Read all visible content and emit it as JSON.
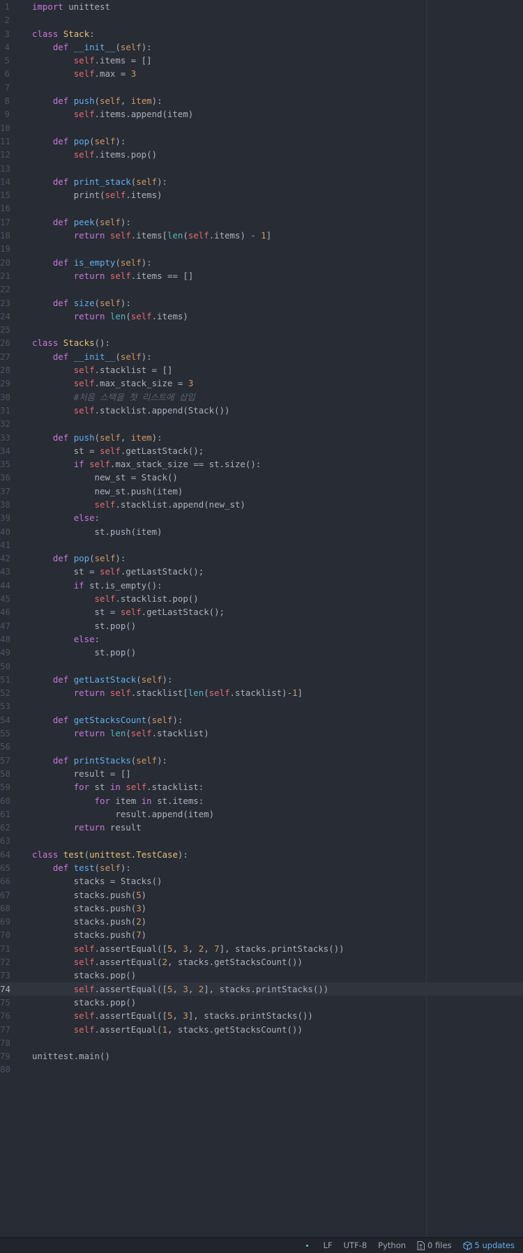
{
  "editor": {
    "cursor_line": 74,
    "colors": {
      "background": "#282c34",
      "keyword": "#c678dd",
      "class_name": "#e5c07b",
      "function": "#61afef",
      "self": "#e06c75",
      "number": "#d19a66",
      "builtin": "#56b6c2",
      "comment": "#5c6370",
      "text": "#abb2bf"
    },
    "lines": [
      [
        [
          "k",
          "import"
        ],
        [
          "t",
          " unittest"
        ]
      ],
      [],
      [
        [
          "k",
          "class"
        ],
        [
          "t",
          " "
        ],
        [
          "cls",
          "Stack"
        ],
        [
          "t",
          ":"
        ]
      ],
      [
        [
          "t",
          "    "
        ],
        [
          "k",
          "def"
        ],
        [
          "t",
          " "
        ],
        [
          "fn",
          "__init__"
        ],
        [
          "t",
          "("
        ],
        [
          "p",
          "self"
        ],
        [
          "t",
          "):"
        ]
      ],
      [
        [
          "t",
          "        "
        ],
        [
          "s",
          "self"
        ],
        [
          "t",
          ".items = []"
        ]
      ],
      [
        [
          "t",
          "        "
        ],
        [
          "s",
          "self"
        ],
        [
          "t",
          ".max = "
        ],
        [
          "n",
          "3"
        ]
      ],
      [],
      [
        [
          "t",
          "    "
        ],
        [
          "k",
          "def"
        ],
        [
          "t",
          " "
        ],
        [
          "fn",
          "push"
        ],
        [
          "t",
          "("
        ],
        [
          "p",
          "self"
        ],
        [
          "t",
          ", "
        ],
        [
          "p",
          "item"
        ],
        [
          "t",
          "):"
        ]
      ],
      [
        [
          "t",
          "        "
        ],
        [
          "s",
          "self"
        ],
        [
          "t",
          ".items.append(item)"
        ]
      ],
      [],
      [
        [
          "t",
          "    "
        ],
        [
          "k",
          "def"
        ],
        [
          "t",
          " "
        ],
        [
          "fn",
          "pop"
        ],
        [
          "t",
          "("
        ],
        [
          "p",
          "self"
        ],
        [
          "t",
          "):"
        ]
      ],
      [
        [
          "t",
          "        "
        ],
        [
          "s",
          "self"
        ],
        [
          "t",
          ".items.pop()"
        ]
      ],
      [],
      [
        [
          "t",
          "    "
        ],
        [
          "k",
          "def"
        ],
        [
          "t",
          " "
        ],
        [
          "fn",
          "print_stack"
        ],
        [
          "t",
          "("
        ],
        [
          "p",
          "self"
        ],
        [
          "t",
          "):"
        ]
      ],
      [
        [
          "t",
          "        print("
        ],
        [
          "s",
          "self"
        ],
        [
          "t",
          ".items)"
        ]
      ],
      [],
      [
        [
          "t",
          "    "
        ],
        [
          "k",
          "def"
        ],
        [
          "t",
          " "
        ],
        [
          "fn",
          "peek"
        ],
        [
          "t",
          "("
        ],
        [
          "p",
          "self"
        ],
        [
          "t",
          "):"
        ]
      ],
      [
        [
          "t",
          "        "
        ],
        [
          "k",
          "return"
        ],
        [
          "t",
          " "
        ],
        [
          "s",
          "self"
        ],
        [
          "t",
          ".items["
        ],
        [
          "b",
          "len"
        ],
        [
          "t",
          "("
        ],
        [
          "s",
          "self"
        ],
        [
          "t",
          ".items) - "
        ],
        [
          "n",
          "1"
        ],
        [
          "t",
          "]"
        ]
      ],
      [],
      [
        [
          "t",
          "    "
        ],
        [
          "k",
          "def"
        ],
        [
          "t",
          " "
        ],
        [
          "fn",
          "is_empty"
        ],
        [
          "t",
          "("
        ],
        [
          "p",
          "self"
        ],
        [
          "t",
          "):"
        ]
      ],
      [
        [
          "t",
          "        "
        ],
        [
          "k",
          "return"
        ],
        [
          "t",
          " "
        ],
        [
          "s",
          "self"
        ],
        [
          "t",
          ".items == []"
        ]
      ],
      [],
      [
        [
          "t",
          "    "
        ],
        [
          "k",
          "def"
        ],
        [
          "t",
          " "
        ],
        [
          "fn",
          "size"
        ],
        [
          "t",
          "("
        ],
        [
          "p",
          "self"
        ],
        [
          "t",
          "):"
        ]
      ],
      [
        [
          "t",
          "        "
        ],
        [
          "k",
          "return"
        ],
        [
          "t",
          " "
        ],
        [
          "b",
          "len"
        ],
        [
          "t",
          "("
        ],
        [
          "s",
          "self"
        ],
        [
          "t",
          ".items)"
        ]
      ],
      [],
      [
        [
          "k",
          "class"
        ],
        [
          "t",
          " "
        ],
        [
          "cls",
          "Stacks"
        ],
        [
          "t",
          "():"
        ]
      ],
      [
        [
          "t",
          "    "
        ],
        [
          "k",
          "def"
        ],
        [
          "t",
          " "
        ],
        [
          "fn",
          "__init__"
        ],
        [
          "t",
          "("
        ],
        [
          "p",
          "self"
        ],
        [
          "t",
          "):"
        ]
      ],
      [
        [
          "t",
          "        "
        ],
        [
          "s",
          "self"
        ],
        [
          "t",
          ".stacklist = []"
        ]
      ],
      [
        [
          "t",
          "        "
        ],
        [
          "s",
          "self"
        ],
        [
          "t",
          ".max_stack_size = "
        ],
        [
          "n",
          "3"
        ]
      ],
      [
        [
          "t",
          "        "
        ],
        [
          "c",
          "#처음 스택을 첫 리스트에 삽입"
        ]
      ],
      [
        [
          "t",
          "        "
        ],
        [
          "s",
          "self"
        ],
        [
          "t",
          ".stacklist.append(Stack())"
        ]
      ],
      [],
      [
        [
          "t",
          "    "
        ],
        [
          "k",
          "def"
        ],
        [
          "t",
          " "
        ],
        [
          "fn",
          "push"
        ],
        [
          "t",
          "("
        ],
        [
          "p",
          "self"
        ],
        [
          "t",
          ", "
        ],
        [
          "p",
          "item"
        ],
        [
          "t",
          "):"
        ]
      ],
      [
        [
          "t",
          "        st = "
        ],
        [
          "s",
          "self"
        ],
        [
          "t",
          ".getLastStack();"
        ]
      ],
      [
        [
          "t",
          "        "
        ],
        [
          "k",
          "if"
        ],
        [
          "t",
          " "
        ],
        [
          "s",
          "self"
        ],
        [
          "t",
          ".max_stack_size == st.size():"
        ]
      ],
      [
        [
          "t",
          "            new_st = Stack()"
        ]
      ],
      [
        [
          "t",
          "            new_st.push(item)"
        ]
      ],
      [
        [
          "t",
          "            "
        ],
        [
          "s",
          "self"
        ],
        [
          "t",
          ".stacklist.append(new_st)"
        ]
      ],
      [
        [
          "t",
          "        "
        ],
        [
          "k",
          "else"
        ],
        [
          "t",
          ":"
        ]
      ],
      [
        [
          "t",
          "            st.push(item)"
        ]
      ],
      [],
      [
        [
          "t",
          "    "
        ],
        [
          "k",
          "def"
        ],
        [
          "t",
          " "
        ],
        [
          "fn",
          "pop"
        ],
        [
          "t",
          "("
        ],
        [
          "p",
          "self"
        ],
        [
          "t",
          "):"
        ]
      ],
      [
        [
          "t",
          "        st = "
        ],
        [
          "s",
          "self"
        ],
        [
          "t",
          ".getLastStack();"
        ]
      ],
      [
        [
          "t",
          "        "
        ],
        [
          "k",
          "if"
        ],
        [
          "t",
          " st.is_empty():"
        ]
      ],
      [
        [
          "t",
          "            "
        ],
        [
          "s",
          "self"
        ],
        [
          "t",
          ".stacklist.pop()"
        ]
      ],
      [
        [
          "t",
          "            st = "
        ],
        [
          "s",
          "self"
        ],
        [
          "t",
          ".getLastStack();"
        ]
      ],
      [
        [
          "t",
          "            st.pop()"
        ]
      ],
      [
        [
          "t",
          "        "
        ],
        [
          "k",
          "else"
        ],
        [
          "t",
          ":"
        ]
      ],
      [
        [
          "t",
          "            st.pop()"
        ]
      ],
      [],
      [
        [
          "t",
          "    "
        ],
        [
          "k",
          "def"
        ],
        [
          "t",
          " "
        ],
        [
          "fn",
          "getLastStack"
        ],
        [
          "t",
          "("
        ],
        [
          "p",
          "self"
        ],
        [
          "t",
          "):"
        ]
      ],
      [
        [
          "t",
          "        "
        ],
        [
          "k",
          "return"
        ],
        [
          "t",
          " "
        ],
        [
          "s",
          "self"
        ],
        [
          "t",
          ".stacklist["
        ],
        [
          "b",
          "len"
        ],
        [
          "t",
          "("
        ],
        [
          "s",
          "self"
        ],
        [
          "t",
          ".stacklist)-"
        ],
        [
          "n",
          "1"
        ],
        [
          "t",
          "]"
        ]
      ],
      [],
      [
        [
          "t",
          "    "
        ],
        [
          "k",
          "def"
        ],
        [
          "t",
          " "
        ],
        [
          "fn",
          "getStacksCount"
        ],
        [
          "t",
          "("
        ],
        [
          "p",
          "self"
        ],
        [
          "t",
          "):"
        ]
      ],
      [
        [
          "t",
          "        "
        ],
        [
          "k",
          "return"
        ],
        [
          "t",
          " "
        ],
        [
          "b",
          "len"
        ],
        [
          "t",
          "("
        ],
        [
          "s",
          "self"
        ],
        [
          "t",
          ".stacklist)"
        ]
      ],
      [],
      [
        [
          "t",
          "    "
        ],
        [
          "k",
          "def"
        ],
        [
          "t",
          " "
        ],
        [
          "fn",
          "printStacks"
        ],
        [
          "t",
          "("
        ],
        [
          "p",
          "self"
        ],
        [
          "t",
          "):"
        ]
      ],
      [
        [
          "t",
          "        result = []"
        ]
      ],
      [
        [
          "t",
          "        "
        ],
        [
          "k",
          "for"
        ],
        [
          "t",
          " st "
        ],
        [
          "k",
          "in"
        ],
        [
          "t",
          " "
        ],
        [
          "s",
          "self"
        ],
        [
          "t",
          ".stacklist:"
        ]
      ],
      [
        [
          "t",
          "            "
        ],
        [
          "k",
          "for"
        ],
        [
          "t",
          " item "
        ],
        [
          "k",
          "in"
        ],
        [
          "t",
          " st.items:"
        ]
      ],
      [
        [
          "t",
          "                result.append(item)"
        ]
      ],
      [
        [
          "t",
          "        "
        ],
        [
          "k",
          "return"
        ],
        [
          "t",
          " result"
        ]
      ],
      [],
      [
        [
          "k",
          "class"
        ],
        [
          "t",
          " "
        ],
        [
          "cls",
          "test"
        ],
        [
          "t",
          "("
        ],
        [
          "cls",
          "unittest.TestCase"
        ],
        [
          "t",
          "):"
        ]
      ],
      [
        [
          "t",
          "    "
        ],
        [
          "k",
          "def"
        ],
        [
          "t",
          " "
        ],
        [
          "fn",
          "test"
        ],
        [
          "t",
          "("
        ],
        [
          "p",
          "self"
        ],
        [
          "t",
          "):"
        ]
      ],
      [
        [
          "t",
          "        stacks = Stacks()"
        ]
      ],
      [
        [
          "t",
          "        stacks.push("
        ],
        [
          "n",
          "5"
        ],
        [
          "t",
          ")"
        ]
      ],
      [
        [
          "t",
          "        stacks.push("
        ],
        [
          "n",
          "3"
        ],
        [
          "t",
          ")"
        ]
      ],
      [
        [
          "t",
          "        stacks.push("
        ],
        [
          "n",
          "2"
        ],
        [
          "t",
          ")"
        ]
      ],
      [
        [
          "t",
          "        stacks.push("
        ],
        [
          "n",
          "7"
        ],
        [
          "t",
          ")"
        ]
      ],
      [
        [
          "t",
          "        "
        ],
        [
          "s",
          "self"
        ],
        [
          "t",
          ".assertEqual(["
        ],
        [
          "n",
          "5"
        ],
        [
          "t",
          ", "
        ],
        [
          "n",
          "3"
        ],
        [
          "t",
          ", "
        ],
        [
          "n",
          "2"
        ],
        [
          "t",
          ", "
        ],
        [
          "n",
          "7"
        ],
        [
          "t",
          "], stacks.printStacks())"
        ]
      ],
      [
        [
          "t",
          "        "
        ],
        [
          "s",
          "self"
        ],
        [
          "t",
          ".assertEqual("
        ],
        [
          "n",
          "2"
        ],
        [
          "t",
          ", stacks.getStacksCount())"
        ]
      ],
      [
        [
          "t",
          "        stacks.pop()"
        ]
      ],
      [
        [
          "t",
          "        "
        ],
        [
          "s",
          "self"
        ],
        [
          "t",
          ".assertEqual(["
        ],
        [
          "n",
          "5"
        ],
        [
          "t",
          ", "
        ],
        [
          "n",
          "3"
        ],
        [
          "t",
          ", "
        ],
        [
          "n",
          "2"
        ],
        [
          "t",
          "], stacks.printStacks())"
        ]
      ],
      [
        [
          "t",
          "        stacks.pop()"
        ]
      ],
      [
        [
          "t",
          "        "
        ],
        [
          "s",
          "self"
        ],
        [
          "t",
          ".assertEqual(["
        ],
        [
          "n",
          "5"
        ],
        [
          "t",
          ", "
        ],
        [
          "n",
          "3"
        ],
        [
          "t",
          "], stacks.printStacks())"
        ]
      ],
      [
        [
          "t",
          "        "
        ],
        [
          "s",
          "self"
        ],
        [
          "t",
          ".assertEqual("
        ],
        [
          "n",
          "1"
        ],
        [
          "t",
          ", stacks.getStacksCount())"
        ]
      ],
      [],
      [
        [
          "t",
          "unittest.main()"
        ]
      ],
      []
    ]
  },
  "status_bar": {
    "line_ending": "LF",
    "encoding": "UTF-8",
    "grammar": "Python",
    "git_files": "0 files",
    "updates": "5 updates",
    "update_color": "#61afef"
  }
}
